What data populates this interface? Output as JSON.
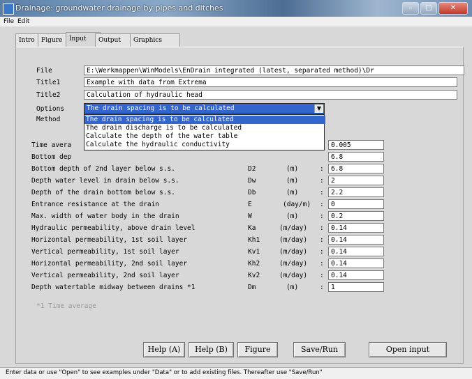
{
  "window": {
    "title": "Drainage: groundwater drainage by pipes and ditches"
  },
  "menu": [
    "File",
    "Edit"
  ],
  "tabs": [
    "Intro",
    "Figure",
    "Input",
    "Output",
    "Graphics"
  ],
  "active_tab": "Input",
  "form": {
    "file_label": "File",
    "file_value": "E:\\Werkmappen\\WinModels\\EnDrain integrated (latest, separated method)\\Dr",
    "title1_label": "Title1",
    "title1_value": "Example with data from Extrema",
    "title2_label": "Title2",
    "title2_value": "Calculation of hydraulic head",
    "options_label": "Options",
    "method_label": "Method",
    "options_selected": "The drain spacing is to be calculated",
    "options_list": [
      "The drain spacing is to be calculated",
      "The drain discharge is to be calculated",
      "Calculate the depth of the water table",
      "Calculate the hydraulic conductivity"
    ]
  },
  "params": [
    {
      "label": "Time avera",
      "sym": "",
      "unit": "",
      "value": "0.005"
    },
    {
      "label": "Bottom dep",
      "sym": "",
      "unit": "",
      "value": "6.8"
    },
    {
      "label": "Bottom depth of 2nd layer below s.s.",
      "sym": "D2",
      "unit": "(m)",
      "value": "6.8"
    },
    {
      "label": "Depth water level in drain below s.s.",
      "sym": "Dw",
      "unit": "(m)",
      "value": "2"
    },
    {
      "label": "Depth of the drain bottom below s.s.",
      "sym": "Db",
      "unit": "(m)",
      "value": "2.2"
    },
    {
      "label": "Entrance resistance at the drain",
      "sym": "E",
      "unit": "(day/m)",
      "value": "0"
    },
    {
      "label": "Max. width of water body in the drain",
      "sym": "W",
      "unit": "(m)",
      "value": "0.2"
    },
    {
      "label": "Hydraulic permeability, above drain level",
      "sym": "Ka",
      "unit": "(m/day)",
      "value": "0.14"
    },
    {
      "label": "Horizontal permeability, 1st soil layer",
      "sym": "Kh1",
      "unit": "(m/day)",
      "value": "0.14"
    },
    {
      "label": "Vertical permeability, 1st soil layer",
      "sym": "Kv1",
      "unit": "(m/day)",
      "value": "0.14"
    },
    {
      "label": "Horizontal permeability, 2nd soil layer",
      "sym": "Kh2",
      "unit": "(m/day)",
      "value": "0.14"
    },
    {
      "label": "Vertical permeability, 2nd soil layer",
      "sym": "Kv2",
      "unit": "(m/day)",
      "value": "0.14"
    },
    {
      "label": "Depth watertable midway between drains *1",
      "sym": "Dm",
      "unit": "(m)",
      "value": "1"
    }
  ],
  "footnote": "*1 Time average",
  "buttons": {
    "help_a": "Help (A)",
    "help_b": "Help (B)",
    "figure": "Figure",
    "save_run": "Save/Run",
    "open_input": "Open input"
  },
  "status": "Enter data or use \"Open\" to see examples under \"Data\" or to add existing files. Thereafter use \"Save/Run\""
}
